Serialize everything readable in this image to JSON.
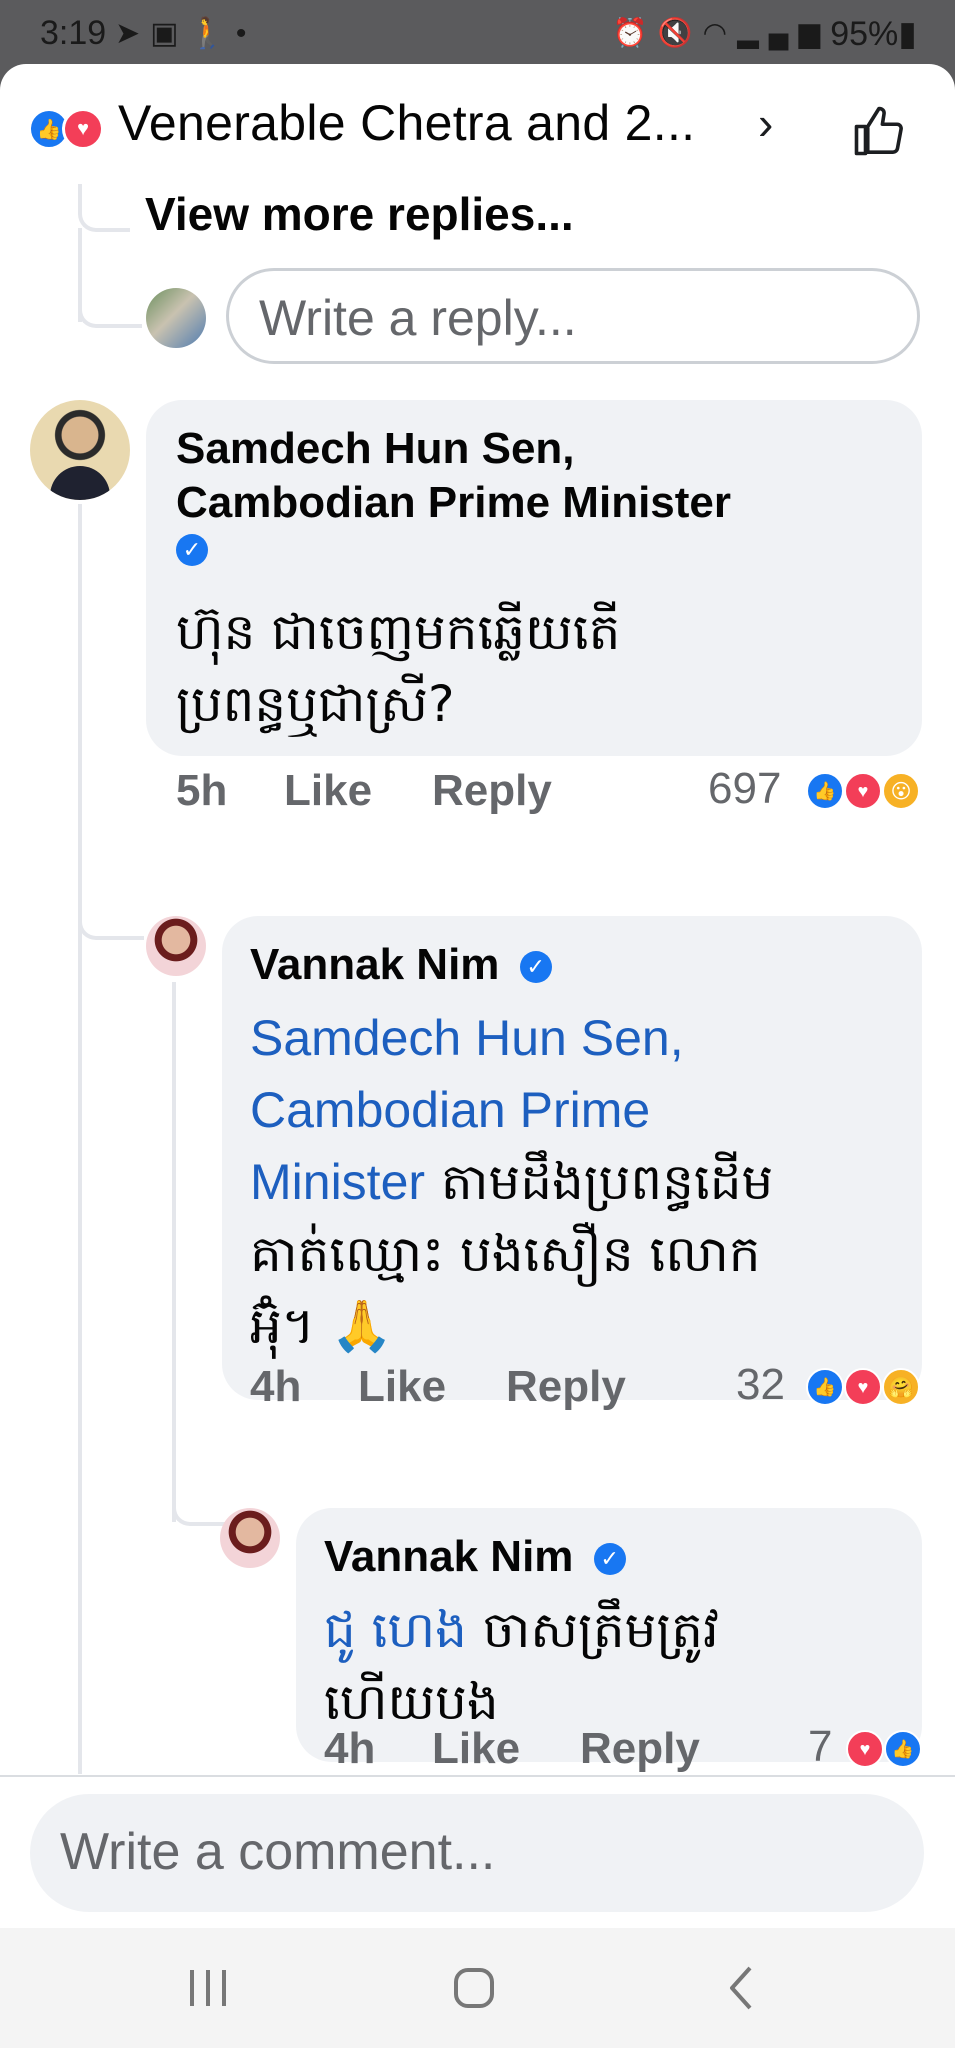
{
  "status_bar": {
    "time": "3:19",
    "battery": "95%",
    "left_icons": [
      "telegram-icon",
      "gallery-icon",
      "walk-icon",
      "dot-icon"
    ],
    "right_icons": [
      "alarm-icon",
      "mute-icon",
      "wifi-icon",
      "signal-icon",
      "call-signal-icon",
      "signal-icon"
    ]
  },
  "header": {
    "title": "Venerable Chetra and 2..."
  },
  "thread": {
    "view_more": "View more replies...",
    "reply_placeholder": "Write a reply..."
  },
  "comments": [
    {
      "author_line1": "Samdech Hun Sen,",
      "author_line2": "Cambodian Prime Minister",
      "body_line1": "ហ៊ុន ជាចេញមកឆ្លើយតើ",
      "body_line2": "ប្រពន្ធឬជាស្រី?",
      "time": "5h",
      "like": "Like",
      "reply": "Reply",
      "reaction_count": "697",
      "reactions": [
        "like",
        "love",
        "wow"
      ]
    },
    {
      "author": "Vannak Nim",
      "mention_line1": "Samdech Hun Sen,",
      "mention_line2": "Cambodian Prime",
      "mention_line3": "Minister",
      "body_line3": " តាមដឹងប្រពន្ធដើម",
      "body_line4": "គាត់ឈ្មោះ បងសឿន លោក",
      "body_line5": "អ៊ុំ។ 🙏",
      "time": "4h",
      "like": "Like",
      "reply": "Reply",
      "reaction_count": "32",
      "reactions": [
        "like",
        "love",
        "care"
      ]
    },
    {
      "author": "Vannak Nim",
      "mention": "ជូ ហេង",
      "body_line1": " ចាសត្រឹមត្រូវ",
      "body_line2": "ហើយបង",
      "time": "4h",
      "like": "Like",
      "reply": "Reply",
      "reaction_count": "7",
      "reactions": [
        "love",
        "like"
      ]
    }
  ],
  "composer": {
    "placeholder": "Write a comment..."
  },
  "nav": {
    "recent": "recent-apps-icon",
    "home": "home-icon",
    "back": "back-icon"
  }
}
